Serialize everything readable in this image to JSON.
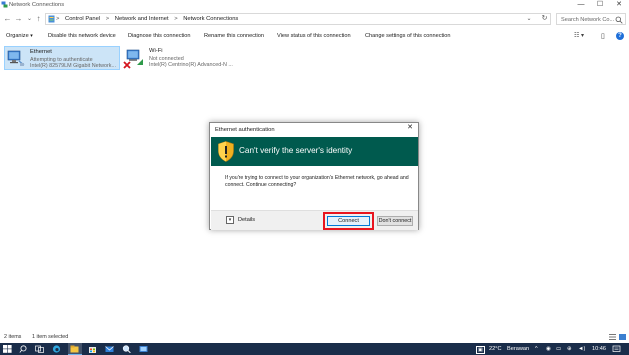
{
  "window": {
    "title": "Network Connections",
    "minimize_glyph": "—",
    "maximize_glyph": "☐",
    "close_glyph": "✕"
  },
  "nav": {
    "back_glyph": "←",
    "forward_glyph": "→",
    "recent_glyph": "⌄",
    "up_glyph": "↑"
  },
  "address": {
    "crumbs": [
      "Control Panel",
      "Network and Internet",
      "Network Connections"
    ],
    "separator": ">",
    "dropdown_glyph": "⌄",
    "refresh_glyph": "↻",
    "search_placeholder": "Search Network Co..."
  },
  "commands": {
    "organize": "Organize",
    "organize_arrow": "▾",
    "disable": "Disable this network device",
    "diagnose": "Diagnose this connection",
    "rename": "Rename this connection",
    "view_status": "View status of this connection",
    "change_settings": "Change settings of this connection",
    "view_options_glyph": "☷ ▾",
    "preview_pane_glyph": "▯",
    "help_glyph": "?"
  },
  "items": [
    {
      "name": "Ethernet",
      "status": "Attempting to authenticate",
      "device": "Intel(R) 82579LM Gigabit Network..."
    },
    {
      "name": "Wi-Fi",
      "status": "Not connected",
      "device": "Intel(R) Centrino(R) Advanced-N ..."
    }
  ],
  "dialog": {
    "title": "Ethernet authentication",
    "close_glyph": "✕",
    "heading": "Can't verify the server's identity",
    "message": "If you're trying to connect to your organization's Ethernet network, go ahead and connect. Continue connecting?",
    "details_label": "Details",
    "details_glyph": "▾",
    "connect_label": "Connect",
    "dont_connect_label": "Don't connect",
    "banner_color": "#005a4e",
    "highlight_color": "#e8141e"
  },
  "status": {
    "count": "2 items",
    "selected": "1 item selected"
  },
  "taskbar": {
    "temperature": "22°C",
    "weather": "Berawan",
    "time": "10:46",
    "tray_glyphs": "^",
    "color": "#1a2d4a"
  }
}
